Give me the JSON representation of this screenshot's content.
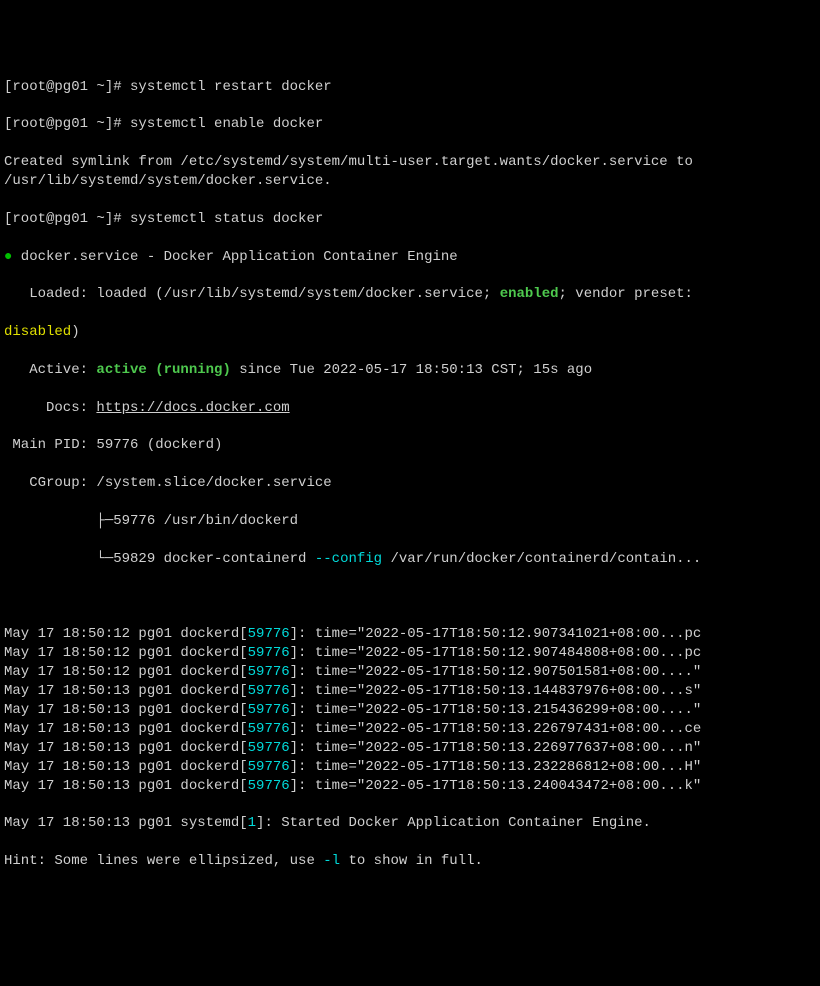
{
  "prompt": "[root@pg01 ~]# ",
  "cmd1": "systemctl restart docker",
  "cmd2": "systemctl enable docker",
  "symlink_line": "Created symlink from /etc/systemd/system/multi-user.target.wants/docker.service to /usr/lib/systemd/system/docker.service.",
  "cmd3": "systemctl status docker",
  "status": {
    "bullet": "●",
    "service_title": " docker.service - Docker Application Container Engine",
    "loaded_label": "   Loaded: ",
    "loaded_val": "loaded (/usr/lib/systemd/system/docker.service; ",
    "enabled": "enabled",
    "vendor_preset": "; vendor preset: ",
    "disabled": "disabled",
    "close_paren": ")",
    "active_label": "   Active: ",
    "active_val": "active (running)",
    "active_since": " since Tue 2022-05-17 18:50:13 CST; 15s ago",
    "docs_label": "     Docs: ",
    "docs_url": "https://docs.docker.com",
    "mainpid_label": " Main PID: ",
    "mainpid_val": "59776 (dockerd)",
    "cgroup_label": "   CGroup: ",
    "cgroup_val": "/system.slice/docker.service",
    "cgroup_1": "           ├─59776 /usr/bin/dockerd",
    "cgroup_2a": "           └─59829 docker-containerd ",
    "cgroup_2b": "--config",
    "cgroup_2c": " /var/run/docker/containerd/contain..."
  },
  "logs": [
    {
      "pre": "May 17 18:50:12 pg01 dockerd[",
      "pid": "59776",
      "post": "]: time=\"2022-05-17T18:50:12.907341021+08:00...pc"
    },
    {
      "pre": "May 17 18:50:12 pg01 dockerd[",
      "pid": "59776",
      "post": "]: time=\"2022-05-17T18:50:12.907484808+08:00...pc"
    },
    {
      "pre": "May 17 18:50:12 pg01 dockerd[",
      "pid": "59776",
      "post": "]: time=\"2022-05-17T18:50:12.907501581+08:00....\""
    },
    {
      "pre": "May 17 18:50:13 pg01 dockerd[",
      "pid": "59776",
      "post": "]: time=\"2022-05-17T18:50:13.144837976+08:00...s\""
    },
    {
      "pre": "May 17 18:50:13 pg01 dockerd[",
      "pid": "59776",
      "post": "]: time=\"2022-05-17T18:50:13.215436299+08:00....\""
    },
    {
      "pre": "May 17 18:50:13 pg01 dockerd[",
      "pid": "59776",
      "post": "]: time=\"2022-05-17T18:50:13.226797431+08:00...ce"
    },
    {
      "pre": "May 17 18:50:13 pg01 dockerd[",
      "pid": "59776",
      "post": "]: time=\"2022-05-17T18:50:13.226977637+08:00...n\""
    },
    {
      "pre": "May 17 18:50:13 pg01 dockerd[",
      "pid": "59776",
      "post": "]: time=\"2022-05-17T18:50:13.232286812+08:00...H\""
    },
    {
      "pre": "May 17 18:50:13 pg01 dockerd[",
      "pid": "59776",
      "post": "]: time=\"2022-05-17T18:50:13.240043472+08:00...k\""
    }
  ],
  "systemd_line_a": "May 17 18:50:13 pg01 systemd[",
  "systemd_pid": "1",
  "systemd_line_b": "]: Started Docker Application Container Engine.",
  "hint_a": "Hint: Some lines were ellipsized, use ",
  "hint_flag": "-l",
  "hint_b": " to show in full."
}
